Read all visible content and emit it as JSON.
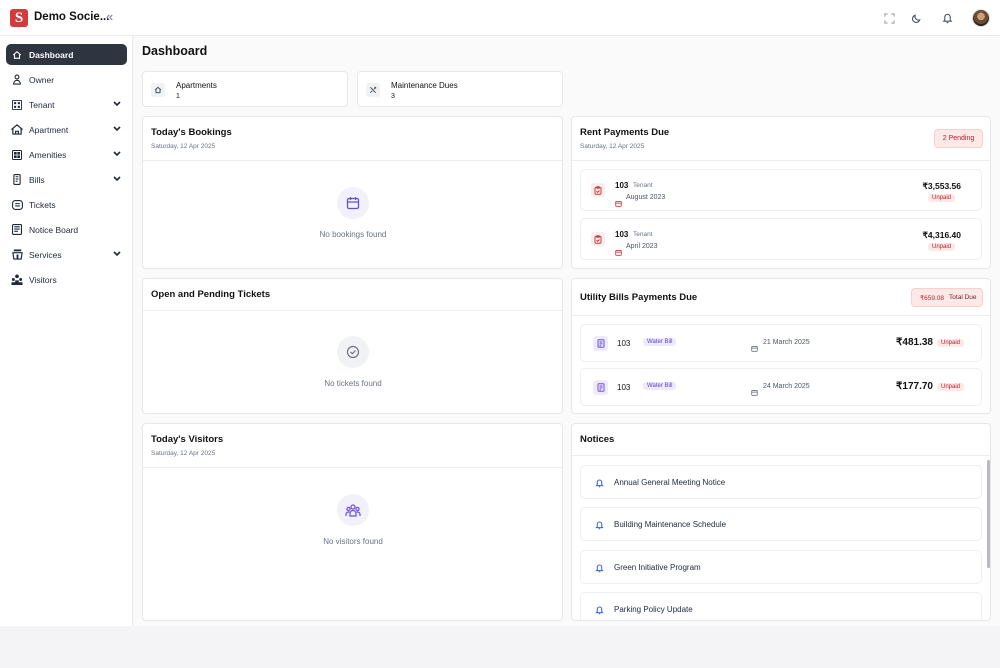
{
  "header": {
    "logo_letter": "S",
    "brand": "Demo Socie...",
    "collapse_glyph": "«"
  },
  "sidebar": {
    "items": [
      {
        "label": "Dashboard",
        "active": true,
        "icon": "home-icon"
      },
      {
        "label": "Owner",
        "icon": "user-icon"
      },
      {
        "label": "Tenant",
        "icon": "building-grid-icon",
        "expandable": true
      },
      {
        "label": "Apartment",
        "icon": "house-icon",
        "expandable": true
      },
      {
        "label": "Amenities",
        "icon": "amenities-icon",
        "expandable": true
      },
      {
        "label": "Bills",
        "icon": "phone-bill-icon",
        "expandable": true
      },
      {
        "label": "Tickets",
        "icon": "ticket-icon"
      },
      {
        "label": "Notice Board",
        "icon": "notice-board-icon"
      },
      {
        "label": "Services",
        "icon": "services-icon",
        "expandable": true
      },
      {
        "label": "Visitors",
        "icon": "visitors-icon"
      }
    ]
  },
  "page": {
    "title": "Dashboard"
  },
  "stats": [
    {
      "label": "Apartments",
      "value": "1"
    },
    {
      "label": "Maintenance Dues",
      "value": "3"
    }
  ],
  "bookings": {
    "title": "Today's Bookings",
    "date": "Saturday, 12 Apr 2025",
    "empty": "No bookings found"
  },
  "tickets": {
    "title": "Open and Pending Tickets",
    "empty": "No tickets found"
  },
  "visitors": {
    "title": "Today's Visitors",
    "date": "Saturday, 12 Apr 2025",
    "empty": "No visitors found"
  },
  "rent": {
    "title": "Rent Payments Due",
    "date": "Saturday, 12 Apr 2025",
    "badge": "2 Pending",
    "rows": [
      {
        "unit": "103",
        "role": "Tenant",
        "month": "August 2023",
        "amount": "₹3,553.56",
        "status": "Unpaid"
      },
      {
        "unit": "103",
        "role": "Tenant",
        "month": "April 2023",
        "amount": "₹4,316.40",
        "status": "Unpaid"
      }
    ]
  },
  "utility": {
    "title": "Utility Bills Payments Due",
    "badge_amount": "₹659.08",
    "badge_label": "Total Due",
    "rows": [
      {
        "unit": "103",
        "type": "Water Bill",
        "date": "21 March 2025",
        "amount": "₹481.38",
        "status": "Unpaid"
      },
      {
        "unit": "103",
        "type": "Water Bill",
        "date": "24 March 2025",
        "amount": "₹177.70",
        "status": "Unpaid"
      }
    ]
  },
  "notices": {
    "title": "Notices",
    "items": [
      "Annual General Meeting Notice",
      "Building Maintenance Schedule",
      "Green Initiative Program",
      "Parking Policy Update"
    ]
  },
  "colors": {
    "accent": "#2f3441",
    "brand_red": "#d23b3b",
    "danger": "#b4232e",
    "purple": "#5b43c9"
  }
}
